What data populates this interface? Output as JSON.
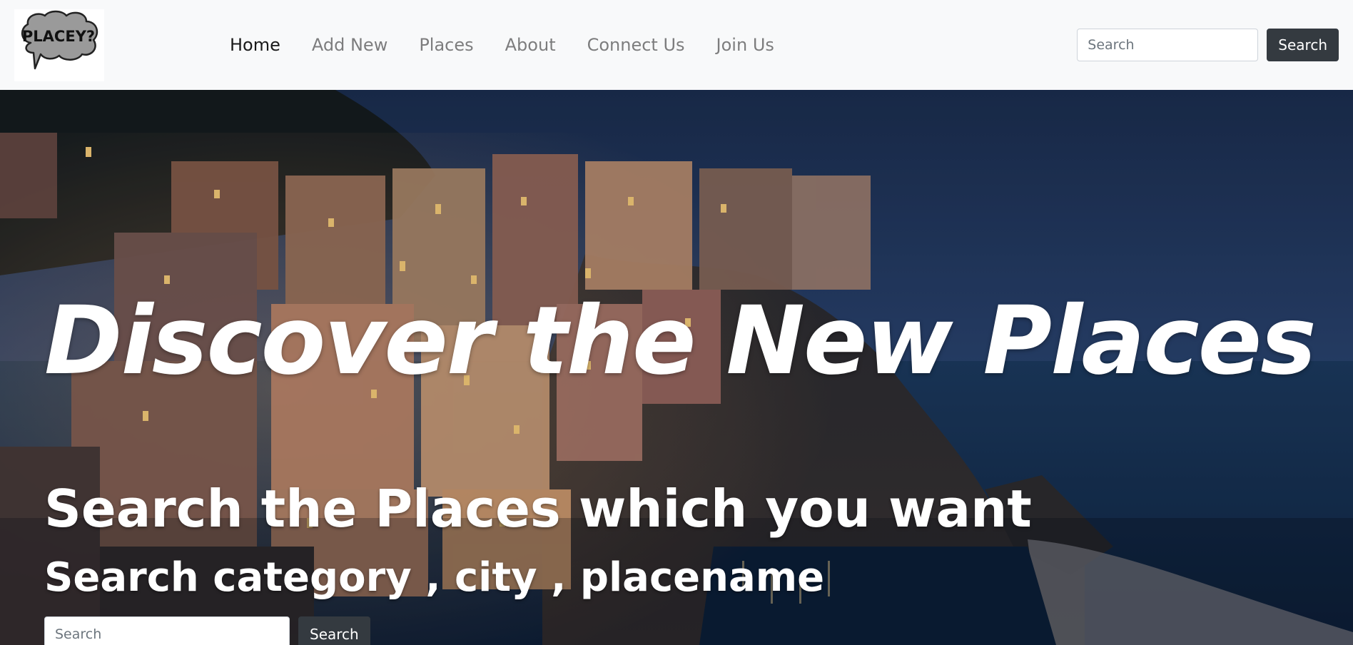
{
  "navbar": {
    "logo_text": "PLACEY?",
    "links": [
      {
        "label": "Home",
        "active": true
      },
      {
        "label": "Add New",
        "active": false
      },
      {
        "label": "Places",
        "active": false
      },
      {
        "label": "About",
        "active": false
      },
      {
        "label": "Connect Us",
        "active": false
      },
      {
        "label": "Join Us",
        "active": false
      }
    ],
    "search_placeholder": "Search",
    "search_button": "Search"
  },
  "hero": {
    "title": "Discover the New Places",
    "subtitle": "Search the Places which you want",
    "subtitle2": "Search category , city , placename",
    "search_placeholder": "Search",
    "search_button": "Search"
  },
  "icons": {
    "logo": "speech-bubble-logo-icon",
    "hero_image": "coastal-village-night-image"
  },
  "colors": {
    "navbar_bg": "#f8f9fa",
    "button_dark": "#343a40",
    "sea_night": "#14304f"
  }
}
